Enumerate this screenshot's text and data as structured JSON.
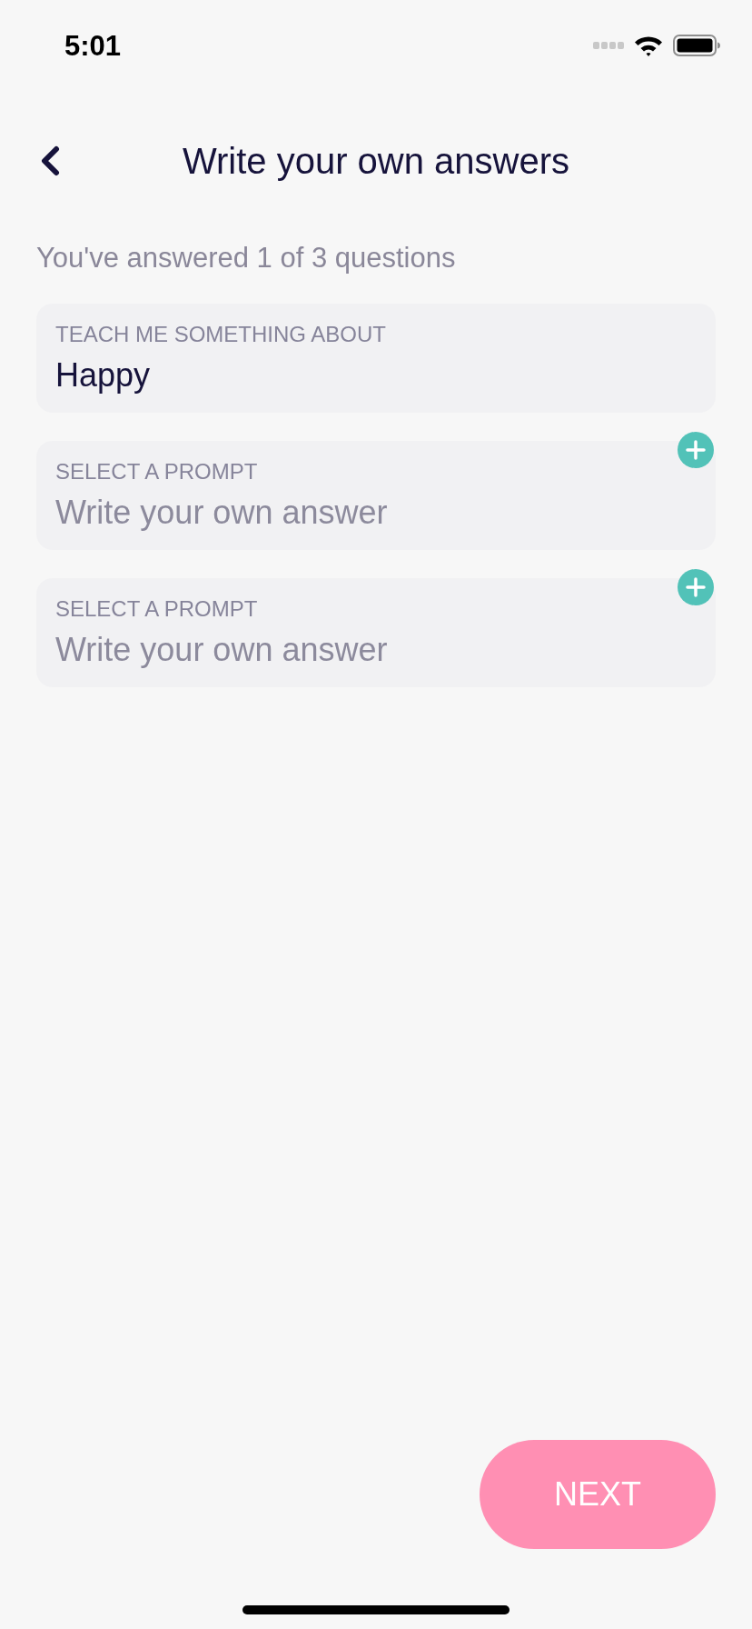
{
  "status_bar": {
    "time": "5:01"
  },
  "header": {
    "title": "Write your own answers"
  },
  "progress_text": "You've answered 1 of 3 questions",
  "prompts": [
    {
      "label": "TEACH ME SOMETHING ABOUT",
      "value": "Happy",
      "add_button": false
    },
    {
      "label": "SELECT A PROMPT",
      "placeholder": "Write your own answer",
      "add_button": true
    },
    {
      "label": "SELECT A PROMPT",
      "placeholder": "Write your own answer",
      "add_button": true
    }
  ],
  "next_button": {
    "label": "NEXT"
  }
}
